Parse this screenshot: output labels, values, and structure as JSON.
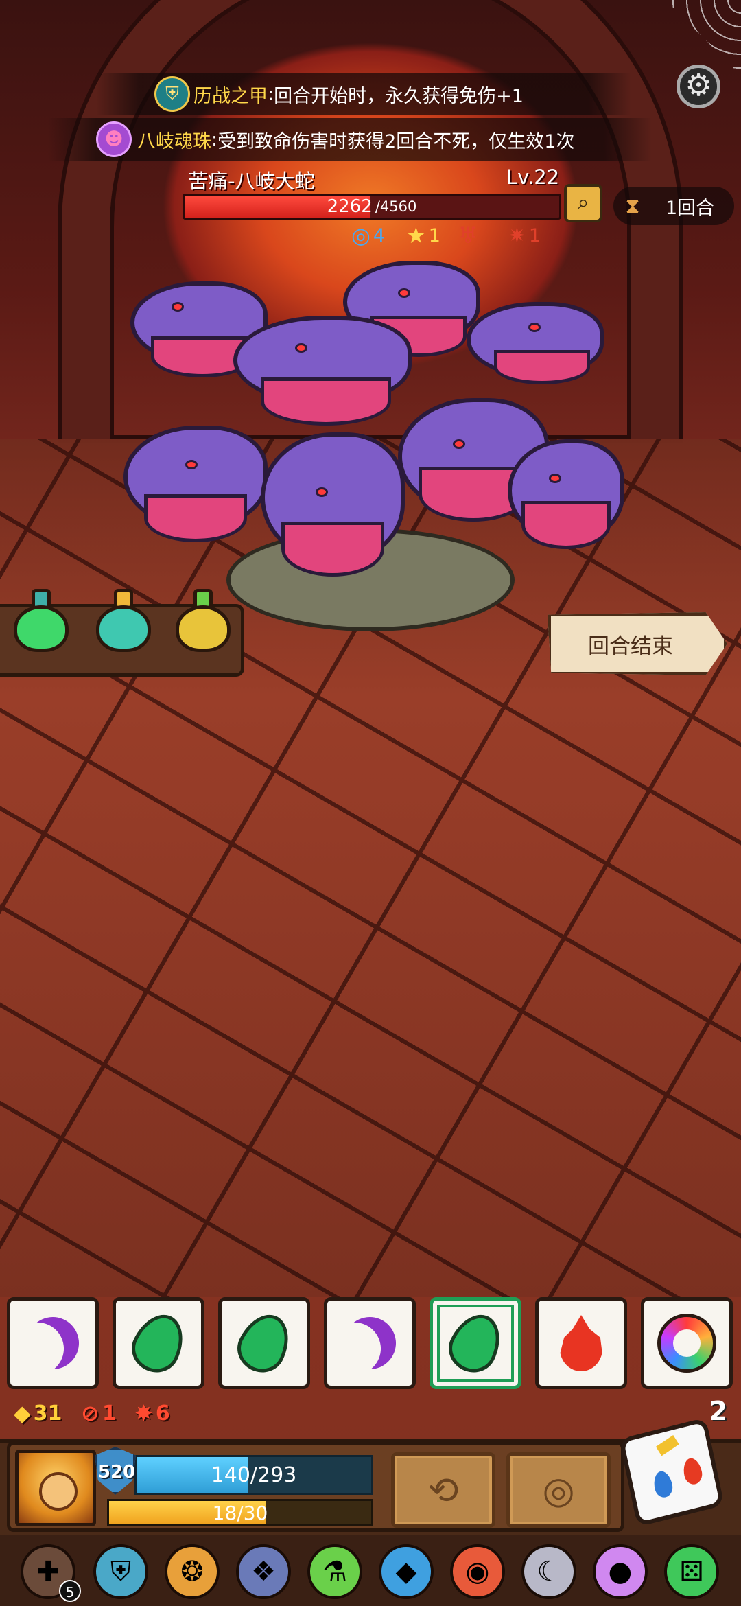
{
  "buffs": [
    {
      "name": "历战之甲",
      "separator": ":",
      "desc": "回合开始时，永久获得免伤+1",
      "icon": "armor-badge-icon"
    },
    {
      "name": "八岐魂珠",
      "separator": ":",
      "desc": "受到致命伤害时获得2回合不死，仅生效1次",
      "icon": "hydra-orb-icon"
    }
  ],
  "boss": {
    "name": "苦痛-八岐大蛇",
    "level": "Lv.22",
    "hp_current": "2262",
    "hp_max": "/4560",
    "hp_fraction": 0.496,
    "stats": [
      {
        "icon": "shield-swirl-icon",
        "value": "4",
        "color": "#4aa8f0"
      },
      {
        "icon": "star-burst-icon",
        "value": "1",
        "color": "#ffd84a"
      },
      {
        "icon": "claw-icon",
        "value": "",
        "color": "#e0402a"
      },
      {
        "icon": "rage-icon",
        "value": "1",
        "color": "#e0402a"
      }
    ]
  },
  "round": {
    "label": "1回合",
    "icon": "hourglass-icon"
  },
  "potions": [
    {
      "name": "green-flask",
      "color": "#3fd86a",
      "cap": "#3fb0a8"
    },
    {
      "name": "teal-pot",
      "color": "#3fc8b0",
      "cap": "#f0b83a"
    },
    {
      "name": "yellow-pot",
      "color": "#e8c43a",
      "cap": "#6ad04a"
    }
  ],
  "end_turn": "回合结束",
  "dice": [
    {
      "face": "moon",
      "selected": false
    },
    {
      "face": "leaf",
      "selected": false
    },
    {
      "face": "leaf",
      "selected": false
    },
    {
      "face": "moon",
      "selected": false
    },
    {
      "face": "leaf",
      "selected": true
    },
    {
      "face": "fire",
      "selected": false
    },
    {
      "face": "swirl",
      "selected": false
    }
  ],
  "resources": [
    {
      "icon": "diamond-icon",
      "value": "31",
      "color": "#ffcf3a"
    },
    {
      "icon": "sword-ring-icon",
      "value": "1",
      "color": "#ff4a30"
    },
    {
      "icon": "burst-icon",
      "value": "6",
      "color": "#ff4a30"
    }
  ],
  "dice_remaining": "2",
  "player": {
    "shield": "520",
    "hp": "140/293",
    "hp_fraction": 0.478,
    "energy": "18/30",
    "energy_fraction": 0.6
  },
  "skills": [
    {
      "icon": "reroll-icon",
      "glyph": "⟲"
    },
    {
      "icon": "vortex-icon",
      "glyph": "◎"
    }
  ],
  "relics": [
    {
      "icon": "cross-relic-icon",
      "glyph": "✚",
      "bg": "#6b4b3a",
      "badge": "5"
    },
    {
      "icon": "armor-relic-icon",
      "glyph": "⛨",
      "bg": "#4aa8c8"
    },
    {
      "icon": "mushroom-relic-icon",
      "glyph": "❂",
      "bg": "#e8a03a"
    },
    {
      "icon": "horn-relic-icon",
      "glyph": "❖",
      "bg": "#6a7ab8"
    },
    {
      "icon": "potion-relic-icon",
      "glyph": "⚗",
      "bg": "#6ad04a"
    },
    {
      "icon": "crystal-relic-icon",
      "glyph": "◆",
      "bg": "#3fa0e0"
    },
    {
      "icon": "target-relic-icon",
      "glyph": "◉",
      "bg": "#e85a3a"
    },
    {
      "icon": "blade-relic-icon",
      "glyph": "☾",
      "bg": "#b8b8c8"
    },
    {
      "icon": "orb-relic-icon",
      "glyph": "●",
      "bg": "#d088f0"
    },
    {
      "icon": "green-die-relic-icon",
      "glyph": "⚄",
      "bg": "#3fc85a"
    }
  ]
}
